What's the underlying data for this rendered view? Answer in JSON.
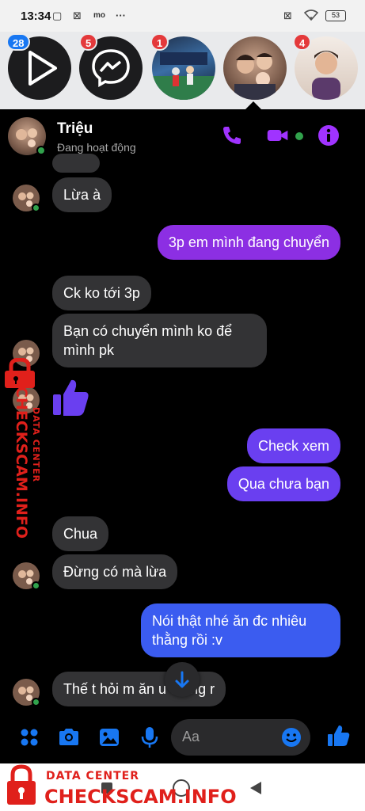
{
  "status_bar": {
    "time": "13:34",
    "battery": "53"
  },
  "bubble_heads": [
    {
      "name": "video-app",
      "badge": "28",
      "badge_color": "#1877f2"
    },
    {
      "name": "messenger",
      "badge": "5",
      "badge_color": "#e4393b"
    },
    {
      "name": "group-chat",
      "badge": "1",
      "badge_color": "#e4393b"
    },
    {
      "name": "family-photo",
      "badge": "",
      "badge_color": ""
    },
    {
      "name": "young-man",
      "badge": "4",
      "badge_color": "#e4393b"
    }
  ],
  "chat_header": {
    "name": "Triệu",
    "status": "Đang hoạt động",
    "accent_color": "#a033ff",
    "icons": [
      "phone-icon",
      "video-camera-icon",
      "info-icon"
    ]
  },
  "messages": [
    {
      "side": "in",
      "text": "Lừa à"
    },
    {
      "side": "out",
      "text": "3p em mình đang chuyển"
    },
    {
      "side": "in",
      "text": "Ck ko tới 3p"
    },
    {
      "side": "in",
      "text": "Bạn có chuyển mình ko để mình pk"
    },
    {
      "side": "in",
      "type": "like",
      "icon": "thumbs-up-icon"
    },
    {
      "side": "out",
      "text": "Check xem"
    },
    {
      "side": "out",
      "text": "Qua chưa bạn"
    },
    {
      "side": "in",
      "text": "Chua"
    },
    {
      "side": "in",
      "text": "Đừng có mà lừa"
    },
    {
      "side": "out",
      "text": "Nói thật nhé ăn đc nhiêu thằng rồi :v"
    },
    {
      "side": "in",
      "text": "Thế t hỏi m ăn u thằng r"
    }
  ],
  "composer": {
    "placeholder": "Aa",
    "icons": [
      "apps-grid-icon",
      "camera-icon",
      "image-icon",
      "microphone-icon",
      "emoji-icon",
      "thumbs-up-icon"
    ],
    "accent_color": "#1877f2"
  },
  "scroll_down": {
    "icon": "arrow-down-icon"
  },
  "watermark": {
    "line1": "DATA CENTER",
    "line2": "CHECKSCAM.INFO",
    "color": "#e0201b"
  }
}
